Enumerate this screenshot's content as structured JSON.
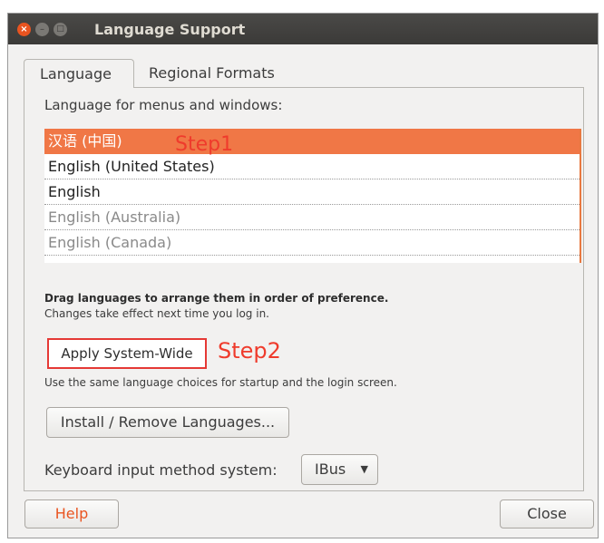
{
  "window": {
    "title": "Language Support",
    "close_glyph": "×",
    "minimize_glyph": "–",
    "maximize_glyph": "□"
  },
  "tabs": [
    {
      "label": "Language",
      "active": true
    },
    {
      "label": "Regional Formats",
      "active": false
    }
  ],
  "language_section": {
    "heading": "Language for menus and windows:",
    "languages": [
      {
        "label": "汉语 (中国)",
        "state": "selected"
      },
      {
        "label": "English (United States)",
        "state": "normal"
      },
      {
        "label": "English",
        "state": "normal"
      },
      {
        "label": "English (Australia)",
        "state": "dim"
      },
      {
        "label": "English (Canada)",
        "state": "dim"
      }
    ],
    "drag_hint": "Drag languages to arrange them in order of preference.",
    "drag_subhint": "Changes take effect next time you log in."
  },
  "annotations": {
    "step1": "Step1",
    "step2": "Step2"
  },
  "apply_button": "Apply System-Wide",
  "apply_description": "Use the same language choices for startup and the login screen.",
  "install_button": "Install / Remove Languages...",
  "keyboard": {
    "label": "Keyboard input method system:",
    "selected": "IBus",
    "arrow_glyph": "▼"
  },
  "footer": {
    "help": "Help",
    "close": "Close"
  },
  "colors": {
    "accent": "#e95420",
    "selection": "#f07746",
    "annotation": "#ef3b2c"
  }
}
